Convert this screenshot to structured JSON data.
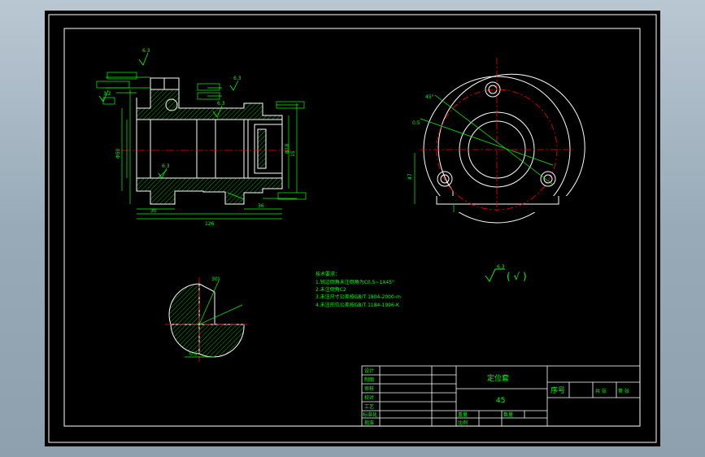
{
  "drawing": {
    "background": "#000000",
    "line_color": "#ffffff",
    "dim_color": "#00ff00",
    "center_color": "#ff0000",
    "hatch_color": "#00ff00",
    "annotations": {
      "roughness_1": "6.3",
      "roughness_2": "3.2",
      "roughness_3": "6.3",
      "roughness_4": "6.3",
      "roughness_5": "6.3",
      "dim_phi_left": "Φ50",
      "dim_len_1": "30",
      "dim_len_2": "36",
      "dim_total": "126",
      "dim_flange_angle": "45°",
      "dim_bore": "Φ18",
      "dim_section_1": "0.5",
      "dim_section_2": "47",
      "dim_section_3": "30°",
      "dim_right_1": "15",
      "note_title": "技术要求：",
      "note_lines": [
        "1.锐边倒角未注倒角为C0.5~1X45°",
        "2.未注倒角C2",
        "3.未注尺寸公差按GB/T 1804-2000-m",
        "4.未注形位公差按GB/T 1184-1996-K"
      ],
      "roughness_general": "6.3",
      "roughness_paren": "( √ )"
    },
    "title_block": {
      "rows_left": [
        "设计",
        "制图",
        "审核",
        "校对",
        "工艺",
        "标准化",
        "批准"
      ],
      "part_name": "定位套",
      "material": "45",
      "serial_label": "序号",
      "cells_right": [
        "共 张",
        "第 张"
      ],
      "weight_label": "重量",
      "scale_label": "比例",
      "sheet_label": "数量"
    }
  }
}
